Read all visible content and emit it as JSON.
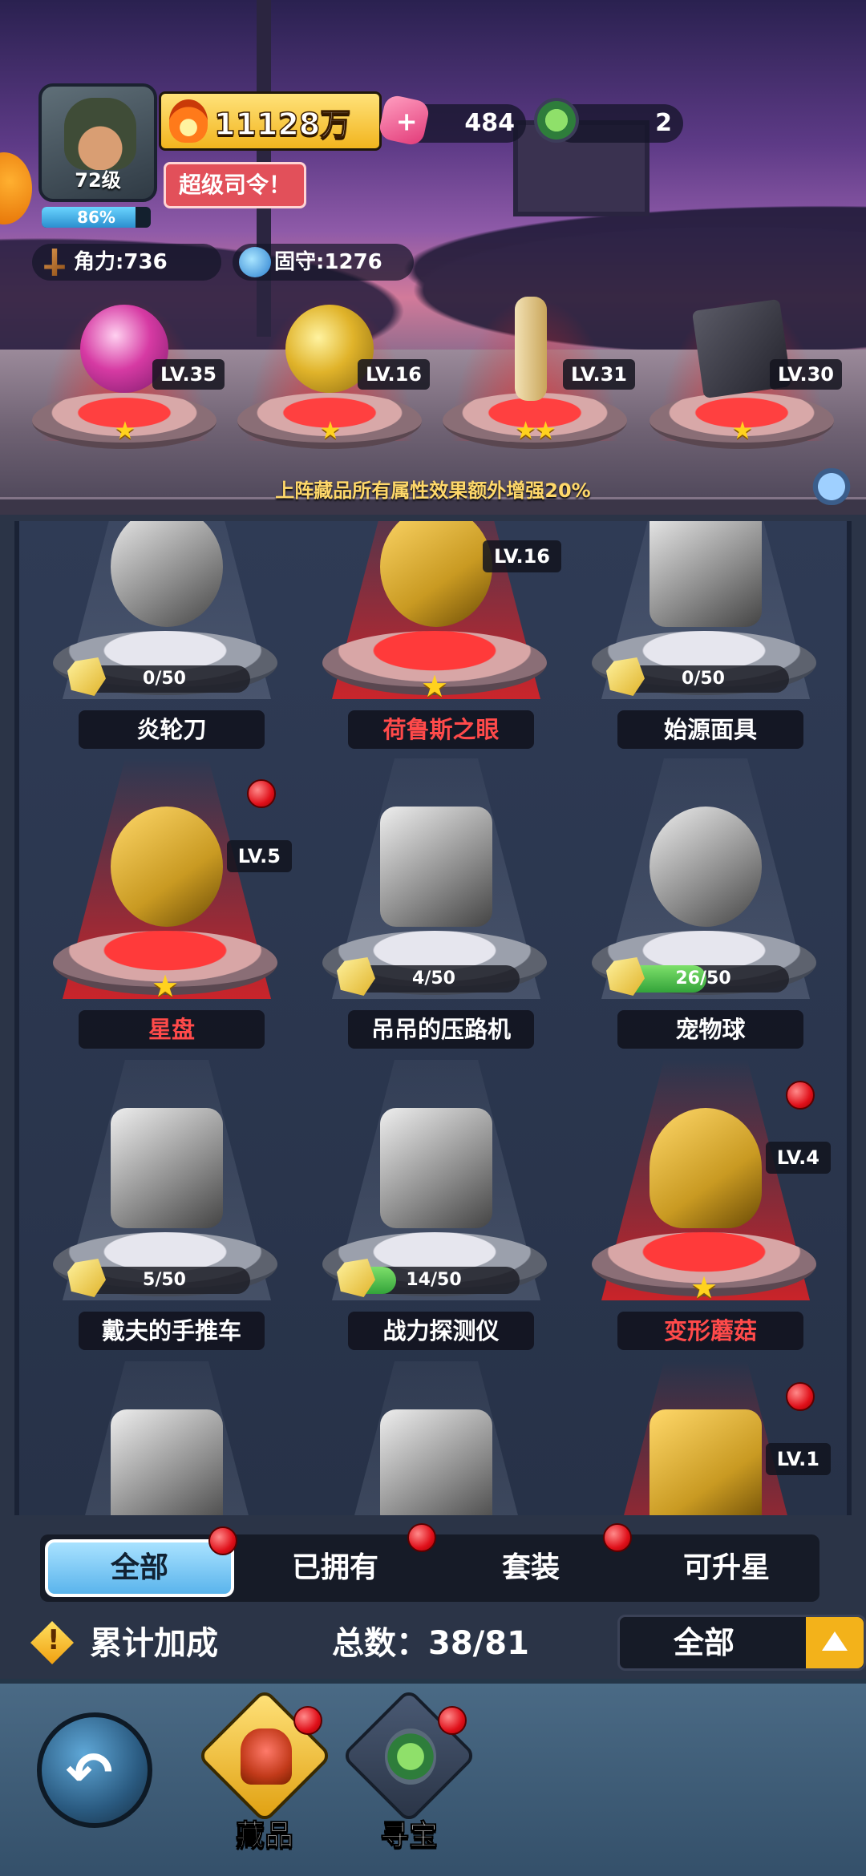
{
  "player": {
    "level": "72级",
    "exp_percent": "86%",
    "exp_fraction": 0.86,
    "power": "11128万",
    "title": "超级司令！",
    "gems": "484",
    "compass": "2",
    "attack_label": "角力:",
    "attack_value": "736",
    "defense_label": "固守:",
    "defense_value": "1276"
  },
  "deployed": [
    {
      "name": "fruit",
      "level": "LV.35",
      "stars": "★"
    },
    {
      "name": "coin",
      "level": "LV.16",
      "stars": "★"
    },
    {
      "name": "staff",
      "level": "LV.31",
      "stars": "★★"
    },
    {
      "name": "book",
      "level": "LV.30",
      "stars": "★"
    }
  ],
  "bonus_text": "上阵藏品所有属性效果额外增强20%",
  "items": [
    {
      "name": "炎轮刀",
      "progress": "0/50",
      "fill": 0
    },
    {
      "name": "荷鲁斯之眼",
      "level": "LV.16",
      "star": "★"
    },
    {
      "name": "始源面具",
      "progress": "0/50",
      "fill": 0
    },
    {
      "name": "星盘",
      "level": "LV.5",
      "star": "★"
    },
    {
      "name": "吊吊的压路机",
      "progress": "4/50",
      "fill": 0.08
    },
    {
      "name": "宠物球",
      "progress": "26/50",
      "fill": 0.52
    },
    {
      "name": "戴夫的手推车",
      "progress": "5/50",
      "fill": 0.1
    },
    {
      "name": "战力探测仪",
      "progress": "14/50",
      "fill": 0.28
    },
    {
      "name": "变形蘑菇",
      "level": "LV.4",
      "star": "★"
    },
    {
      "name": "",
      "progress": ""
    },
    {
      "name": "",
      "progress": ""
    },
    {
      "name": "",
      "level": "LV.1"
    }
  ],
  "tabs": [
    "全部",
    "已拥有",
    "套装",
    "可升星"
  ],
  "summary": {
    "label": "累计加成",
    "total": "总数：38/81",
    "sort": "全部"
  },
  "nav": {
    "collection": "藏品",
    "treasure": "寻宝"
  }
}
